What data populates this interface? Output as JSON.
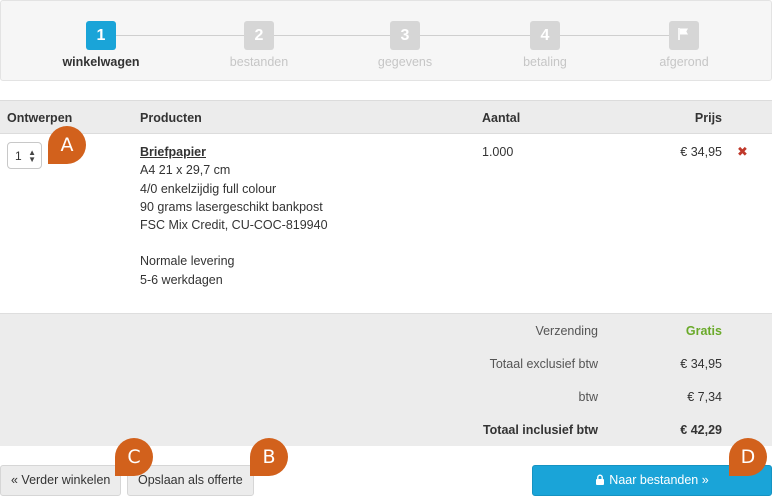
{
  "stepper": {
    "steps": [
      {
        "number": "1",
        "label": "winkelwagen",
        "active": true
      },
      {
        "number": "2",
        "label": "bestanden",
        "active": false
      },
      {
        "number": "3",
        "label": "gegevens",
        "active": false
      },
      {
        "number": "4",
        "label": "betaling",
        "active": false
      },
      {
        "icon": "flag-icon",
        "label": "afgerond",
        "active": false
      }
    ]
  },
  "table": {
    "headers": {
      "designs": "Ontwerpen",
      "products": "Producten",
      "quantity": "Aantal",
      "price": "Prijs"
    },
    "row": {
      "designs_value": "1",
      "product_name": "Briefpapier",
      "product_lines": [
        "A4 21 x 29,7 cm",
        "4/0 enkelzijdig full colour",
        "90 grams lasergeschikt bankpost",
        "FSC Mix Credit, CU-COC-819940"
      ],
      "delivery_lines": [
        "Normale levering",
        "5-6 werkdagen"
      ],
      "quantity": "1.000",
      "price": "€ 34,95",
      "remove_symbol": "✖"
    }
  },
  "summary": {
    "shipping_label": "Verzending",
    "shipping_value": "Gratis",
    "subtotal_label": "Totaal exclusief btw",
    "subtotal_value": "€ 34,95",
    "vat_label": "btw",
    "vat_value": "€ 7,34",
    "total_label": "Totaal inclusief btw",
    "total_value": "€ 42,29"
  },
  "buttons": {
    "continue_shopping": "« Verder winkelen",
    "save_quote": "Opslaan als offerte",
    "to_files": "Naar bestanden »"
  },
  "markers": {
    "a": "A",
    "b": "B",
    "c": "C",
    "d": "D"
  },
  "colors": {
    "accent": "#1aa4d8",
    "marker": "#d2611c",
    "free": "#6aaa2a",
    "remove": "#c0392b"
  }
}
